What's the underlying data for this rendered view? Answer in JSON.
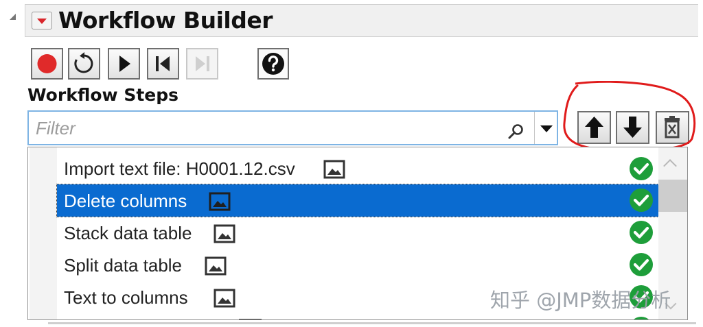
{
  "panel": {
    "title": "Workflow Builder"
  },
  "toolbar": {
    "buttons": [
      {
        "name": "record",
        "icon": "record-icon",
        "color": "#e02a2a"
      },
      {
        "name": "reset",
        "icon": "reset-icon"
      },
      {
        "name": "play",
        "icon": "play-icon"
      },
      {
        "name": "step-back",
        "icon": "step-back-icon"
      },
      {
        "name": "step-forward",
        "icon": "step-forward-icon",
        "disabled": true
      },
      {
        "name": "help",
        "icon": "help-icon"
      }
    ]
  },
  "steps": {
    "label": "Workflow Steps",
    "filter_placeholder": "Filter",
    "actions": [
      {
        "name": "move-up",
        "icon": "arrow-up-icon"
      },
      {
        "name": "move-down",
        "icon": "arrow-down-icon"
      },
      {
        "name": "delete",
        "icon": "trash-icon"
      }
    ],
    "items": [
      {
        "label": "Import text file: H0001.12.csv",
        "status": "check-icon",
        "selected": false
      },
      {
        "label": "Delete columns",
        "status": "check-icon",
        "selected": true
      },
      {
        "label": "Stack data table",
        "status": "check-icon",
        "selected": false
      },
      {
        "label": "Split data table",
        "status": "check-icon",
        "selected": false
      },
      {
        "label": "Text to columns",
        "status": "check-icon",
        "selected": false
      }
    ]
  },
  "colors": {
    "selection": "#0a6bd0",
    "status_ok": "#1e9e3a",
    "annotation": "#e01b1b"
  },
  "watermark": "知乎 @JMP数据分析"
}
